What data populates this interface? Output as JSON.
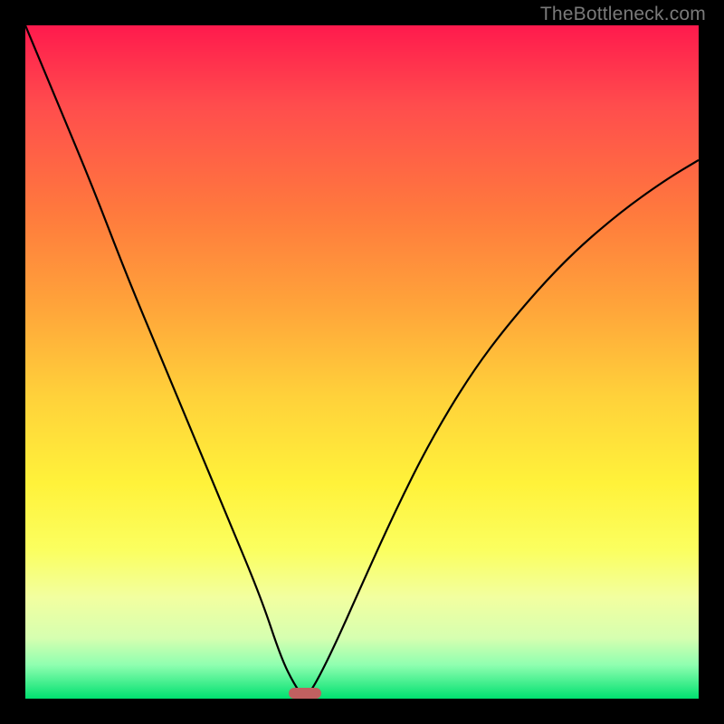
{
  "watermark": "TheBottleneck.com",
  "chart_data": {
    "type": "line",
    "title": "",
    "xlabel": "",
    "ylabel": "",
    "xlim": [
      0,
      100
    ],
    "ylim": [
      0,
      100
    ],
    "background_gradient": [
      {
        "stop": 0,
        "color": "#ff1a4d"
      },
      {
        "stop": 55,
        "color": "#ffd13a"
      },
      {
        "stop": 78,
        "color": "#fbff60"
      },
      {
        "stop": 100,
        "color": "#00e070"
      }
    ],
    "series": [
      {
        "name": "bottleneck-curve",
        "x": [
          0,
          5,
          10,
          15,
          20,
          25,
          30,
          35,
          38,
          40,
          41.5,
          43,
          46,
          50,
          55,
          60,
          66,
          72,
          80,
          88,
          95,
          100
        ],
        "values": [
          100,
          88,
          76,
          63,
          51,
          39,
          27,
          15,
          6,
          2,
          0,
          2,
          8,
          17,
          28,
          38,
          48,
          56,
          65,
          72,
          77,
          80
        ]
      }
    ],
    "marker": {
      "x": 41.5,
      "y": 0,
      "color": "#c06060"
    }
  }
}
